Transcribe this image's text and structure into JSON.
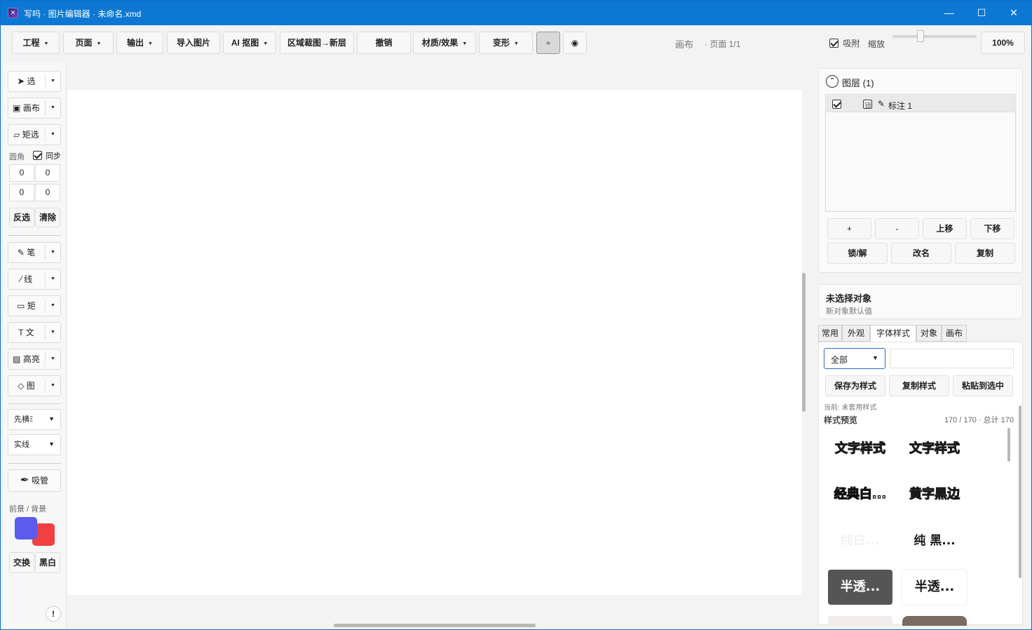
{
  "window": {
    "title": "写吗 · 图片编辑器 · 未命名.xmd",
    "controls": {
      "minimize": "—",
      "maximize": "☐",
      "close": "✕"
    }
  },
  "toolbar": {
    "menus": [
      {
        "label": "工程"
      },
      {
        "label": "页面"
      },
      {
        "label": "输出"
      }
    ],
    "import_image": "导入图片",
    "ai_cutout": "AI 抠图",
    "crop_to_layer": "区域裁图→新层",
    "undo": "撤销",
    "material_effects": "材质/效果",
    "transform": "变形",
    "mode_a_icon": "⌖",
    "mode_b_icon": "◉",
    "canvas_label": "画布",
    "page_info": "· 页面 1/1",
    "snap_label": "吸附",
    "snap_checked": true,
    "zoom_label": "缩放",
    "zoom_value": "100%",
    "zoom_slider_fraction": 0.33
  },
  "tools": {
    "select": "选",
    "canvas": "画布",
    "rect_select": "矩选",
    "corner_label": "圆角",
    "sync_label": "同步",
    "sync_checked": true,
    "corners": [
      "0",
      "0",
      "0",
      "0"
    ],
    "invert": "反选",
    "clear": "清除",
    "pen": "笔",
    "line": "线",
    "rect": "矩",
    "text": "文",
    "highlight": "高亮",
    "image": "图",
    "fg_mode": "先横ﾐ",
    "line_style": "实线",
    "eyedropper": "吸管",
    "color_label": "前景 / 背景",
    "fg_color": "#5b5bf0",
    "bg_color": "#f04040",
    "swap": "交换",
    "black_white": "黑白",
    "info": "!"
  },
  "layers": {
    "title": "图层",
    "count": "(1)",
    "items": [
      {
        "visible": true,
        "locked": false,
        "lock_label": "锁",
        "name": "标注 1"
      }
    ],
    "add": "+",
    "remove": "-",
    "move_up": "上移",
    "move_down": "下移",
    "lock_unlock": "锁/解",
    "rename": "改名",
    "duplicate": "复制"
  },
  "properties": {
    "title": "未选择对象",
    "subtitle": "新对象默认值",
    "tabs": [
      "常用",
      "外观",
      "字体样式",
      "对象",
      "画布"
    ],
    "active_tab": "字体样式",
    "filter_value": "全部",
    "search_value": "",
    "save_style": "保存为样式",
    "copy_style": "复制样式",
    "paste_style": "粘贴到选中",
    "current": "当前: 未套用样式",
    "preview_label": "样式预览",
    "preview_count": "170 / 170 · 总计 170",
    "previews": [
      {
        "text": "文字样式"
      },
      {
        "text": "文字样式"
      },
      {
        "text": "经典白..."
      },
      {
        "text": "黄字黑边"
      },
      {
        "text": "纯白..."
      },
      {
        "text": "纯 黑..."
      },
      {
        "text": "半透..."
      },
      {
        "text": "半透..."
      }
    ]
  }
}
